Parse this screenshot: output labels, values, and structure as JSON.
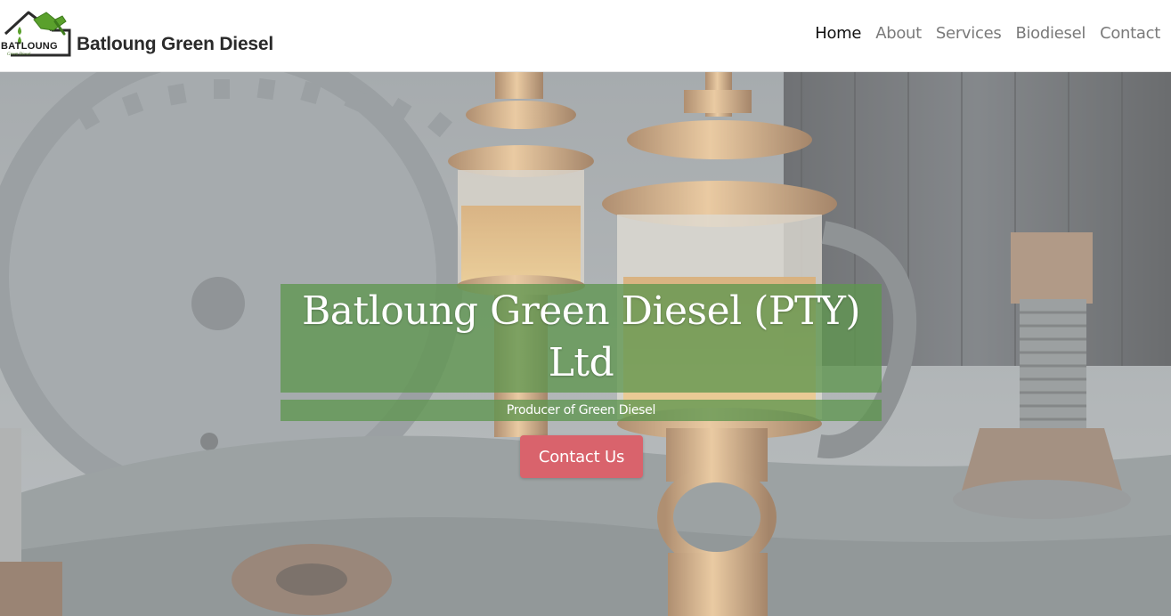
{
  "brand": {
    "logo_word": "BATLOUNG",
    "logo_sub": "Green Diesel",
    "title": "Batloung Green Diesel"
  },
  "nav": {
    "items": [
      {
        "label": "Home",
        "active": true
      },
      {
        "label": "About",
        "active": false
      },
      {
        "label": "Services",
        "active": false
      },
      {
        "label": "Biodiesel",
        "active": false
      },
      {
        "label": "Contact",
        "active": false
      }
    ]
  },
  "hero": {
    "title": "Batloung Green Diesel (PTY) Ltd",
    "subtitle": "Producer of Green Diesel",
    "cta_label": "Contact Us",
    "band_color": "#5f9650",
    "cta_color": "#d9636c"
  },
  "icons": {
    "logo": "fuel-pump-house-icon"
  }
}
